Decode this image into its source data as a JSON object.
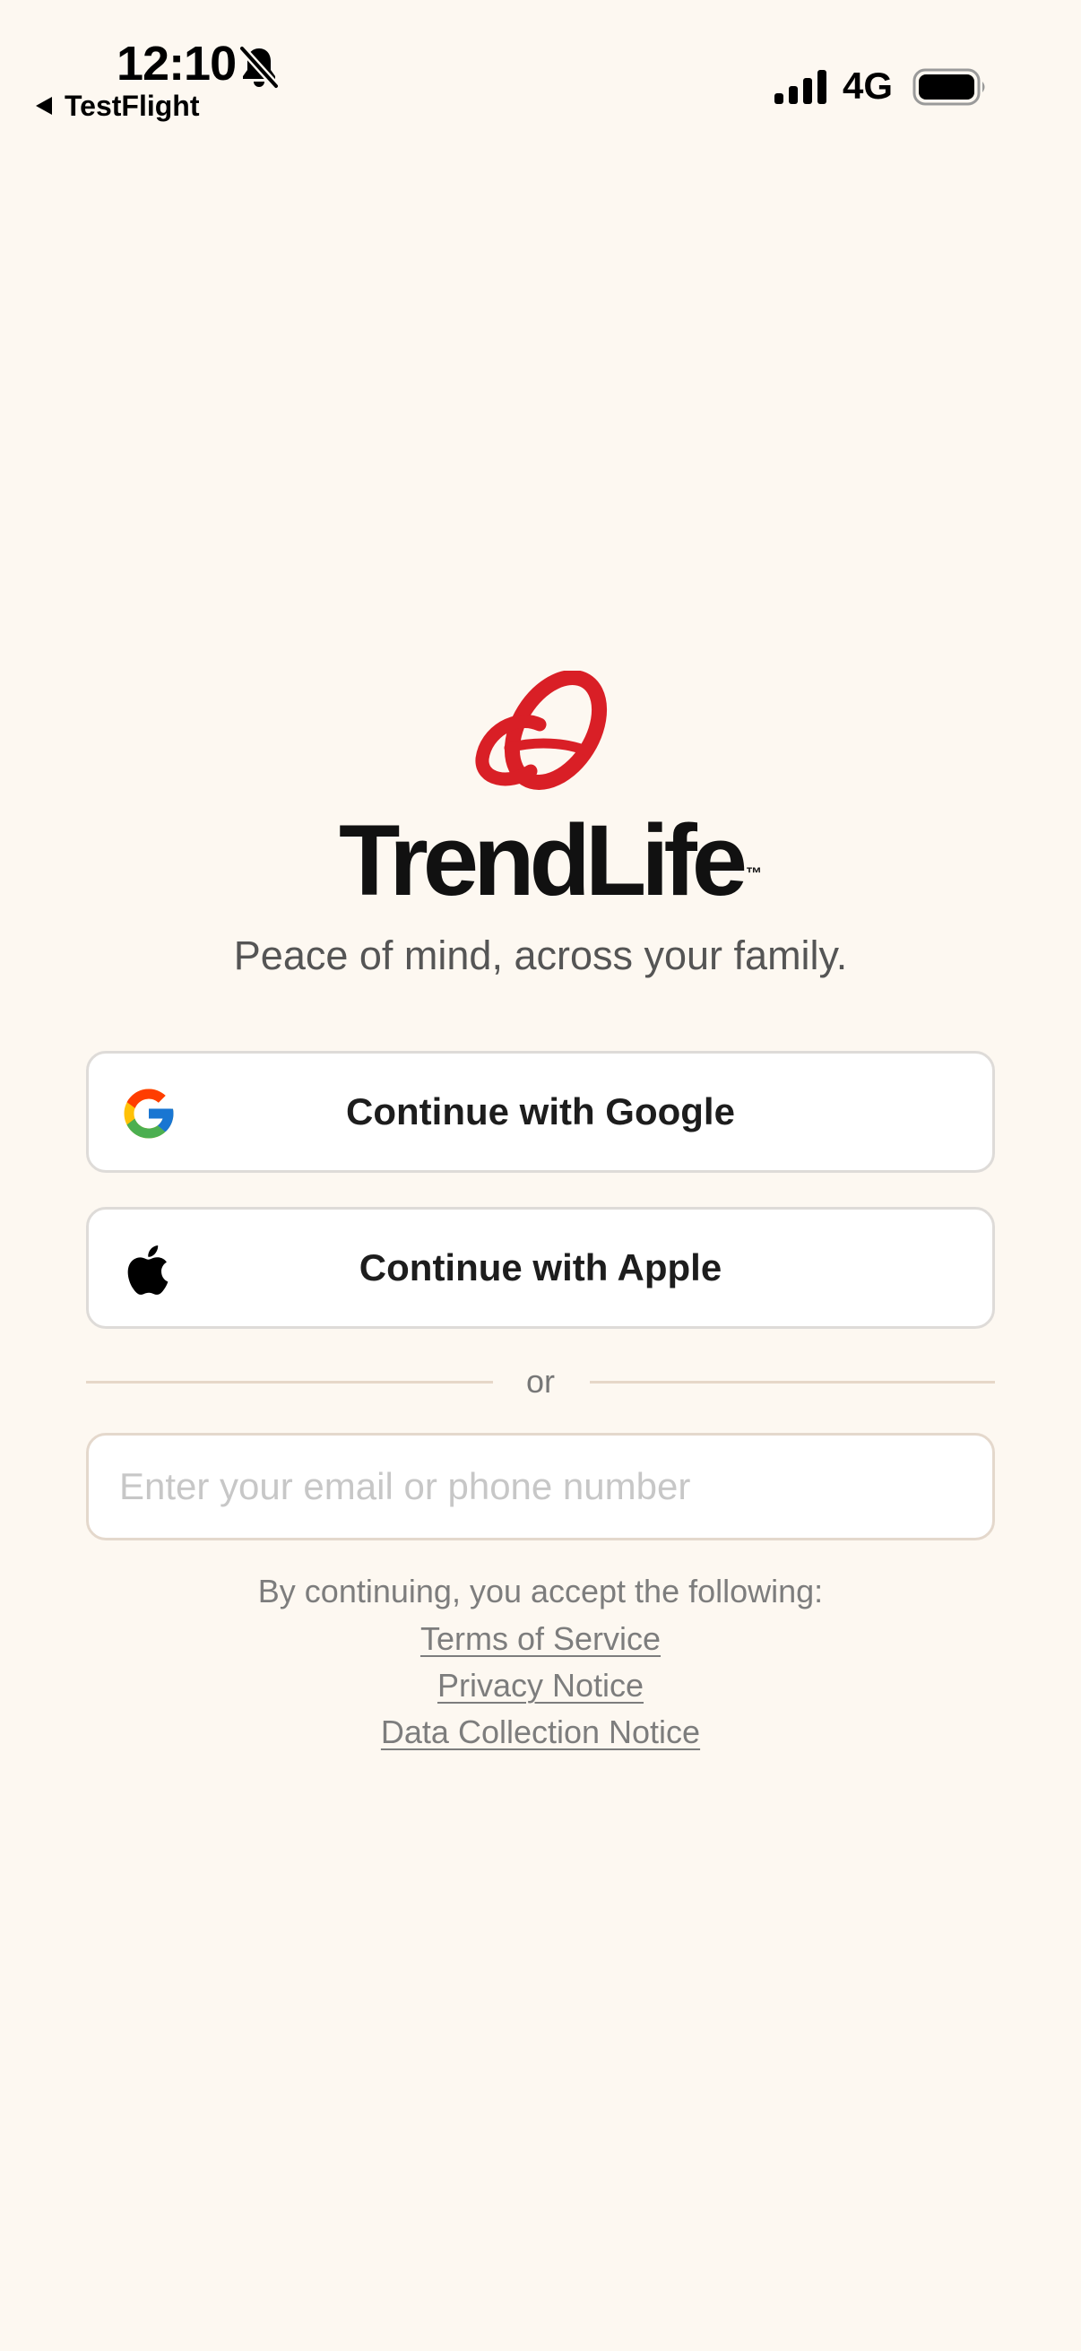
{
  "status_bar": {
    "time": "12:10",
    "back_label": "TestFlight",
    "network": "4G",
    "icons": [
      "bell-slash-icon",
      "back-triangle-icon",
      "cellular-signal-icon",
      "battery-icon"
    ]
  },
  "brand": {
    "name": "TrendLife",
    "trademark": "™",
    "tagline": "Peace of mind, across your family.",
    "accent_color": "#d91f26"
  },
  "auth": {
    "google_label": "Continue with Google",
    "apple_label": "Continue with Apple",
    "divider_label": "or",
    "email_placeholder": "Enter your email or phone number",
    "email_value": ""
  },
  "legal": {
    "intro": "By continuing, you accept the following:",
    "links": [
      "Terms of Service",
      "Privacy Notice",
      "Data Collection Notice"
    ]
  },
  "colors": {
    "background": "#fdf8f1",
    "button_border": "#dedbd8",
    "divider": "#e6d7c8",
    "muted_text": "#7d7d7d"
  }
}
